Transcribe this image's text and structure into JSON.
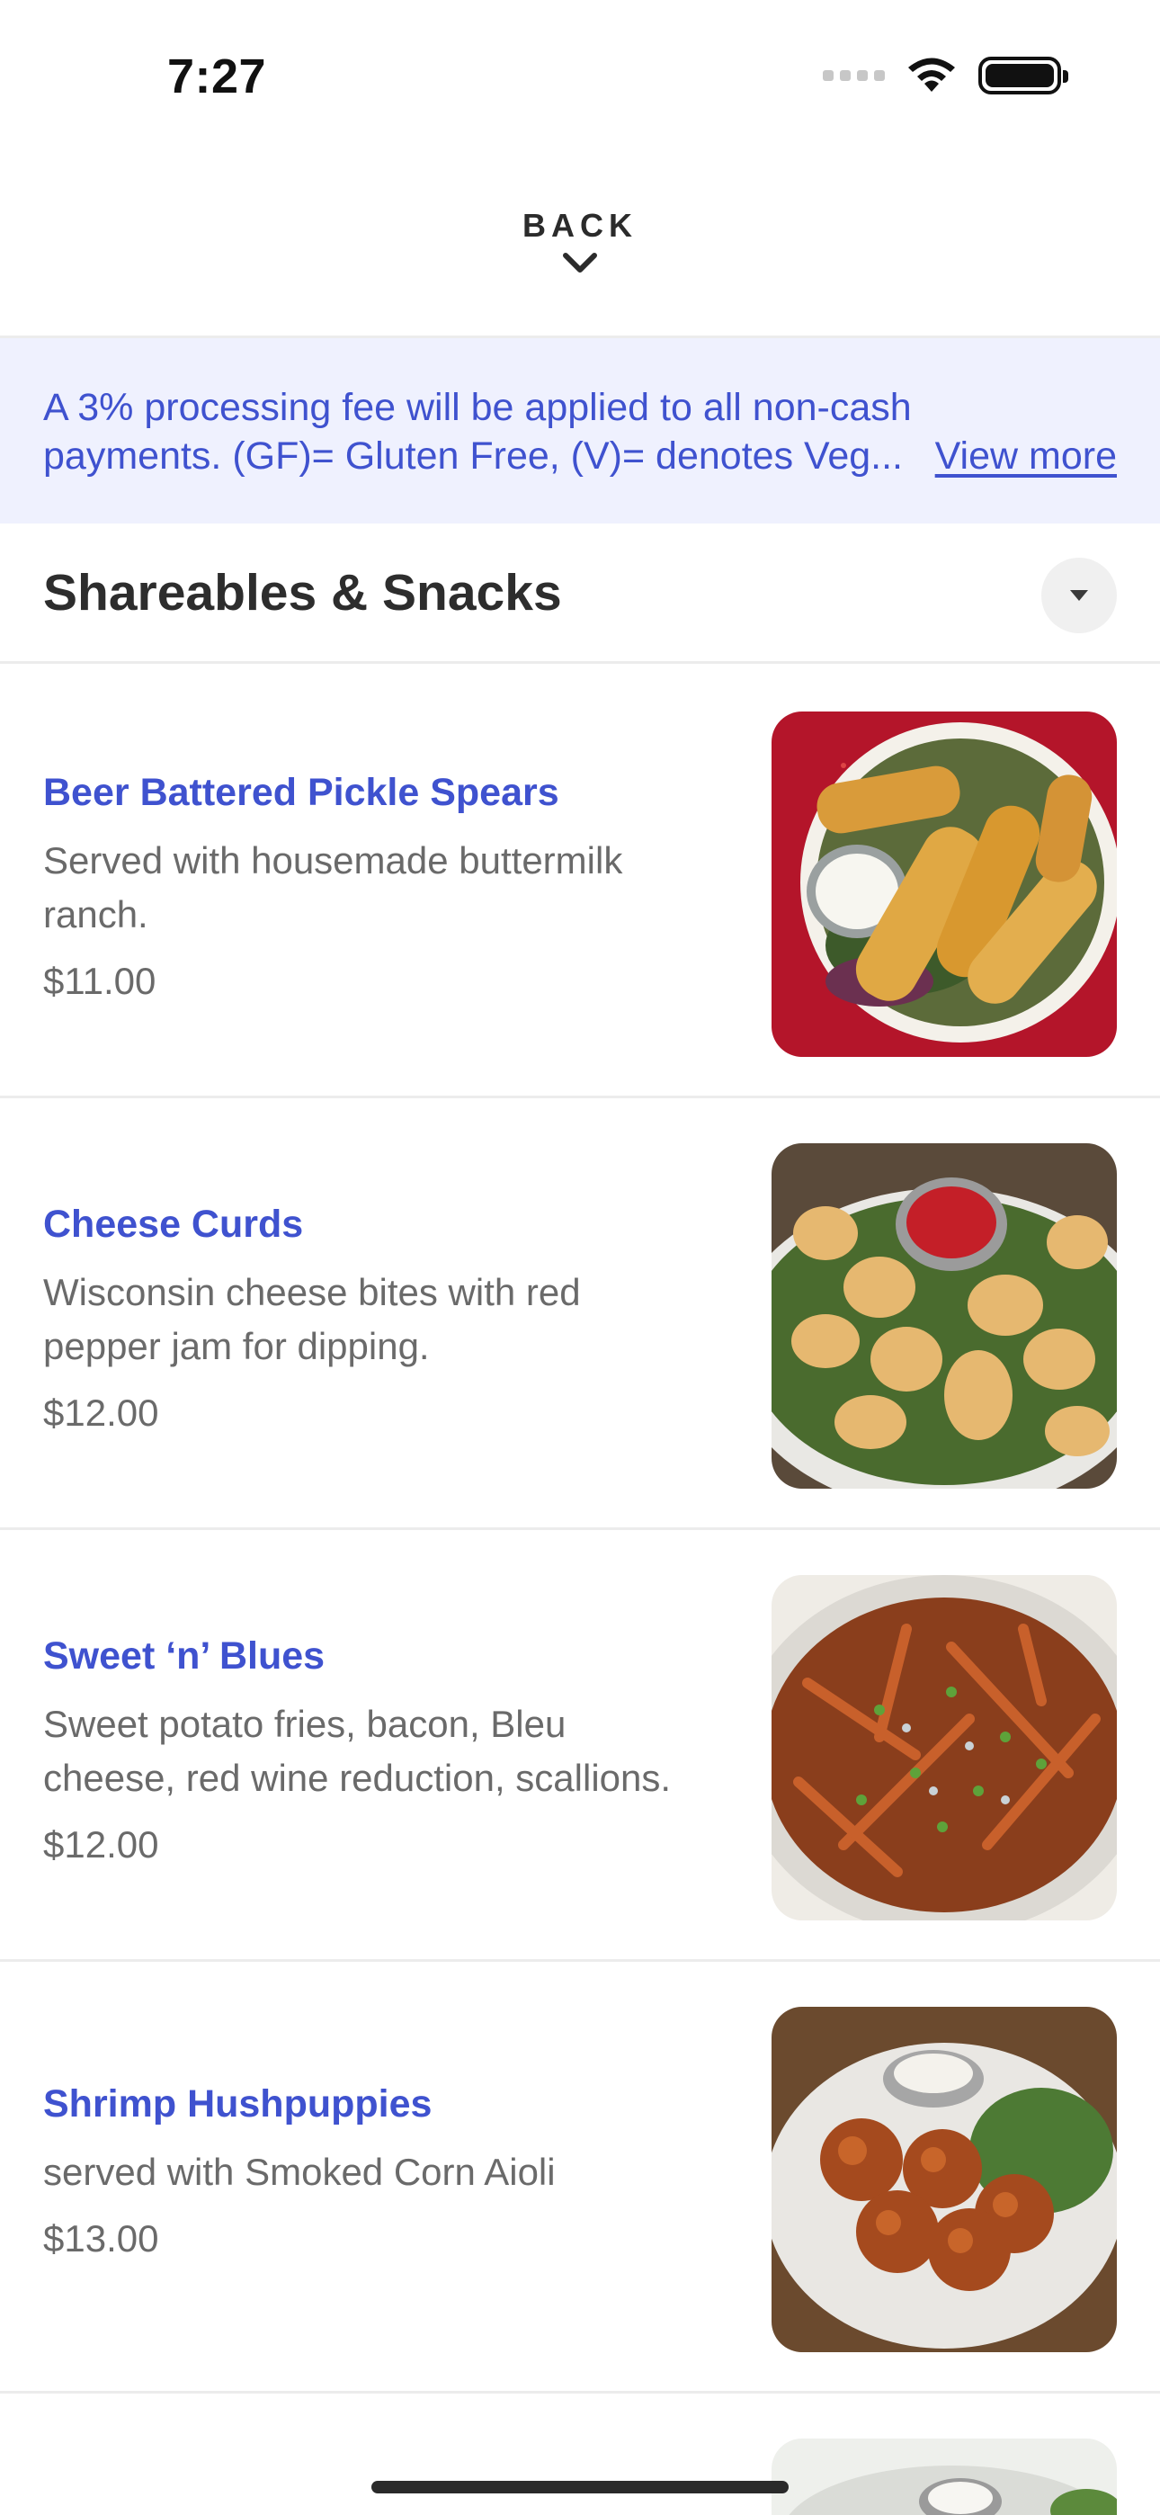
{
  "status_bar": {
    "time": "7:27"
  },
  "header": {
    "back_label": "BACK"
  },
  "notice": {
    "line1": "A 3% processing fee will be applied to all non-cash",
    "line2": "payments. (GF)= Gluten Free, (V)= denotes Veg...",
    "view_more": "View more"
  },
  "section": {
    "title": "Shareables & Snacks"
  },
  "items": [
    {
      "name": "Beer Battered Pickle Spears",
      "desc1": "Served with housemade buttermilk",
      "desc2": "ranch.",
      "price": "$11.00"
    },
    {
      "name": "Cheese Curds",
      "desc1": "Wisconsin cheese bites with red",
      "desc2": "pepper jam for dipping.",
      "price": "$12.00"
    },
    {
      "name": "Sweet ‘n’ Blues",
      "desc1": "Sweet potato fries, bacon, Bleu",
      "desc2": "cheese, red wine reduction, scallions.",
      "price": "$12.00"
    },
    {
      "name": "Shrimp Hushpuppies",
      "desc1": "served with Smoked Corn Aioli",
      "desc2": "",
      "price": "$13.00"
    }
  ],
  "colors": {
    "accent": "#3f52cf",
    "notice_bg": "#eff1fe",
    "text_muted": "#6a6a6a"
  }
}
